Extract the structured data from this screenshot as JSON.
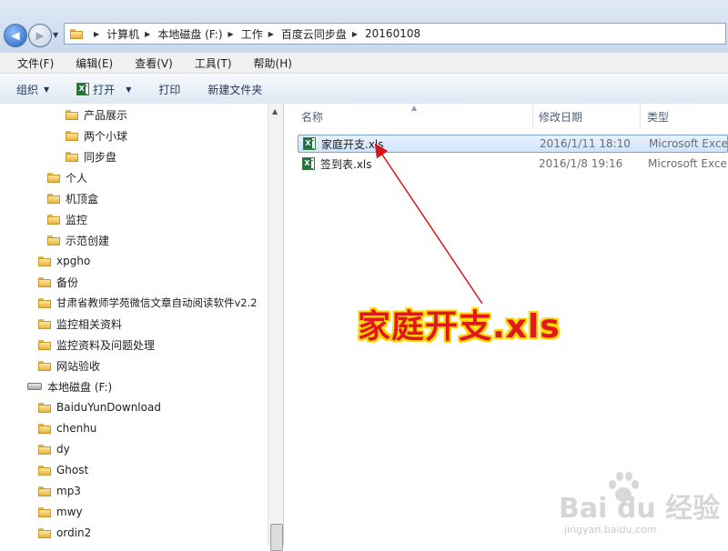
{
  "address_bar": {
    "crumbs": [
      "计算机",
      "本地磁盘 (F:)",
      "工作",
      "百度云同步盘",
      "20160108"
    ]
  },
  "menu": {
    "file": "文件(F)",
    "edit": "编辑(E)",
    "view": "查看(V)",
    "tools": "工具(T)",
    "help": "帮助(H)"
  },
  "toolbar": {
    "organize": "组织",
    "open": "打开",
    "print": "打印",
    "new_folder": "新建文件夹"
  },
  "nav_tree": {
    "items": [
      {
        "label": "产品展示",
        "icon": "folder-icon"
      },
      {
        "label": "两个小球",
        "icon": "folder-icon"
      },
      {
        "label": "同步盘",
        "icon": "folder-icon"
      },
      {
        "label": "个人",
        "icon": "folder-icon"
      },
      {
        "label": "机顶盒",
        "icon": "folder-icon"
      },
      {
        "label": "监控",
        "icon": "folder-icon"
      },
      {
        "label": "示范创建",
        "icon": "folder-icon"
      },
      {
        "label": "xpgho",
        "icon": "folder-icon"
      },
      {
        "label": "备份",
        "icon": "folder-icon"
      },
      {
        "label": "甘肃省教师学苑微信文章自动阅读软件v2.2",
        "icon": "folder-icon"
      },
      {
        "label": "监控相关资料",
        "icon": "folder-icon"
      },
      {
        "label": "监控资料及问题处理",
        "icon": "folder-icon"
      },
      {
        "label": "网站验收",
        "icon": "folder-icon"
      },
      {
        "label": "本地磁盘 (F:)",
        "icon": "drive-icon"
      },
      {
        "label": "BaiduYunDownload",
        "icon": "folder-icon"
      },
      {
        "label": "chenhu",
        "icon": "folder-icon"
      },
      {
        "label": "dy",
        "icon": "folder-icon"
      },
      {
        "label": "Ghost",
        "icon": "folder-icon"
      },
      {
        "label": "mp3",
        "icon": "folder-icon"
      },
      {
        "label": "mwy",
        "icon": "folder-icon"
      },
      {
        "label": "ordin2",
        "icon": "folder-icon"
      }
    ]
  },
  "columns": {
    "name": "名称",
    "modified": "修改日期",
    "type": "类型"
  },
  "files": [
    {
      "name": "家庭开支.xls",
      "modified": "2016/1/11 18:10",
      "type": "Microsoft Excel",
      "selected": true
    },
    {
      "name": "签到表.xls",
      "modified": "2016/1/8 19:16",
      "type": "Microsoft Excel",
      "selected": false
    }
  ],
  "annotation": {
    "text": "家庭开支.xls",
    "color": "#e0181c",
    "outline_color": "#ffd700"
  },
  "watermark": {
    "brand": "Bai du 经验",
    "url": "jingyan.baidu.com"
  }
}
